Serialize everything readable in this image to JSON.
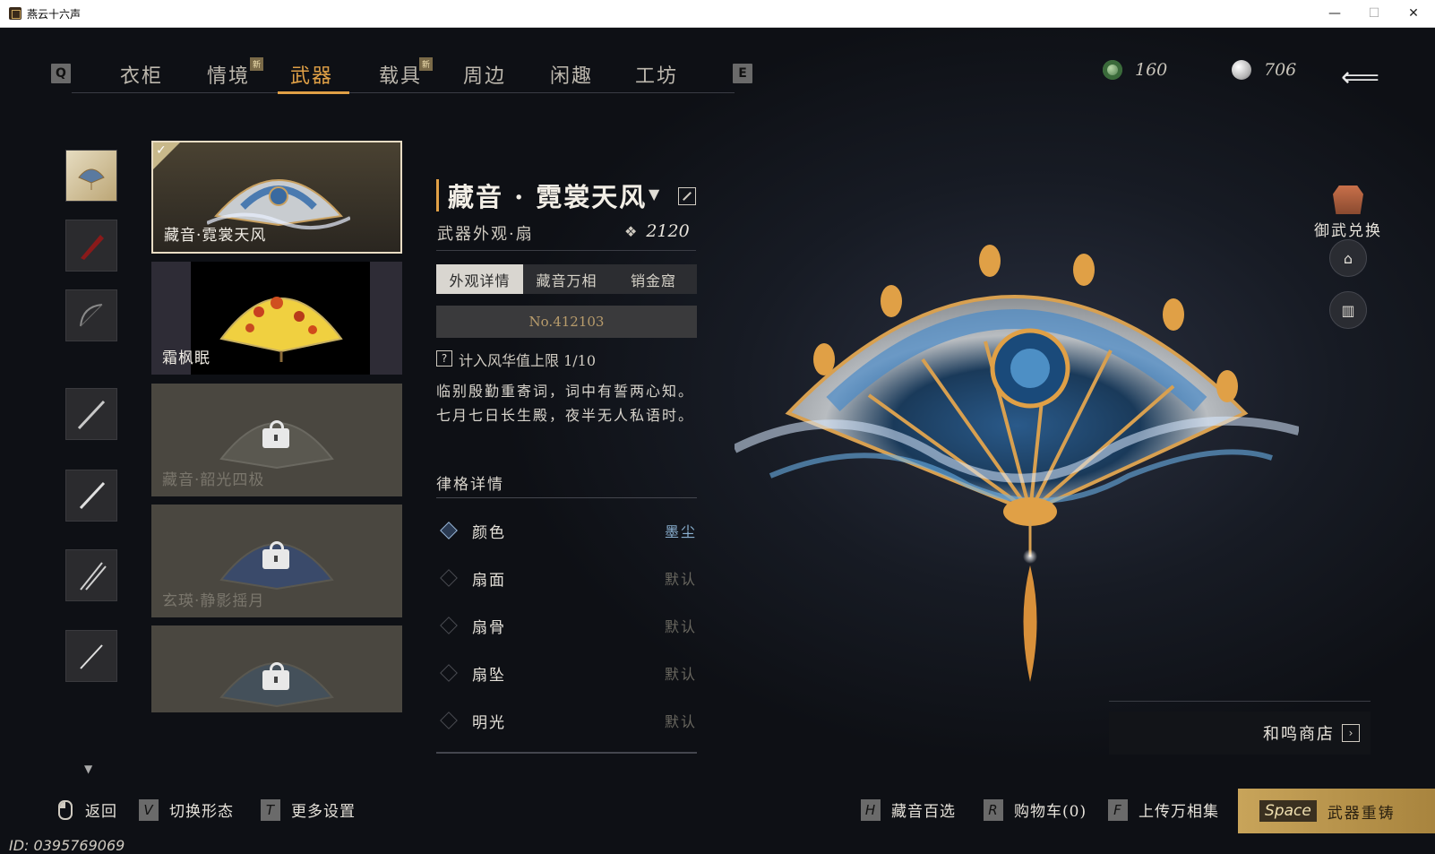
{
  "window": {
    "title": "燕云十六声",
    "minimize": "—",
    "maximize": "☐",
    "close": "✕"
  },
  "nav": {
    "prev_key": "Q",
    "next_key": "E",
    "tabs": [
      {
        "label": "衣柜",
        "badge": ""
      },
      {
        "label": "情境",
        "badge": "新"
      },
      {
        "label": "武器",
        "badge": "",
        "active": true
      },
      {
        "label": "载具",
        "badge": "新"
      },
      {
        "label": "周边",
        "badge": ""
      },
      {
        "label": "闲趣",
        "badge": ""
      },
      {
        "label": "工坊",
        "badge": ""
      }
    ]
  },
  "currencies": [
    {
      "icon": "jade-coin-icon",
      "value": "160",
      "color": "#6a9a6a"
    },
    {
      "icon": "pearl-icon",
      "value": "706",
      "color": "#e0e0e0"
    }
  ],
  "weapon_list": [
    {
      "name": "藏音·霓裳天风",
      "selected": true,
      "locked": false
    },
    {
      "name": "霜枫眠",
      "selected": false,
      "locked": false
    },
    {
      "name": "藏音·韶光四极",
      "selected": false,
      "locked": true
    },
    {
      "name": "玄瑛·静影摇月",
      "selected": false,
      "locked": true
    },
    {
      "name": "",
      "selected": false,
      "locked": true
    }
  ],
  "detail": {
    "title": "藏音 · 霓裳天风",
    "subtitle": "武器外观·扇",
    "power": "2120",
    "tabs": [
      "外观详情",
      "藏音万相",
      "销金窟"
    ],
    "serial": "No.412103",
    "count_label": "计入风华值上限 1/10",
    "help": "?",
    "description": "临别殷勤重寄词，词中有誓两心知。 七月七日长生殿，夜半无人私语时。",
    "attributes_heading": "律格详情",
    "attributes": [
      {
        "name": "颜色",
        "value": "墨尘"
      },
      {
        "name": "扇面",
        "value": "默认"
      },
      {
        "name": "扇骨",
        "value": "默认"
      },
      {
        "name": "扇坠",
        "value": "默认"
      },
      {
        "name": "明光",
        "value": "默认"
      }
    ]
  },
  "right_panel": {
    "exchange_label": "御武兑换",
    "shop_label": "和鸣商店"
  },
  "bottom": {
    "back_label": "返回",
    "switch": {
      "key": "V",
      "label": "切换形态"
    },
    "more": {
      "key": "T",
      "label": "更多设置"
    },
    "collection": {
      "key": "H",
      "label": "藏音百选"
    },
    "cart": {
      "key": "R",
      "label": "购物车(0)"
    },
    "upload": {
      "key": "F",
      "label": "上传万相集"
    },
    "recast": {
      "key": "Space",
      "label": "武器重铸"
    }
  },
  "uid": "ID: 0395769069",
  "colors": {
    "accent": "#e0a046",
    "selected_value": "#8ab0d0"
  }
}
